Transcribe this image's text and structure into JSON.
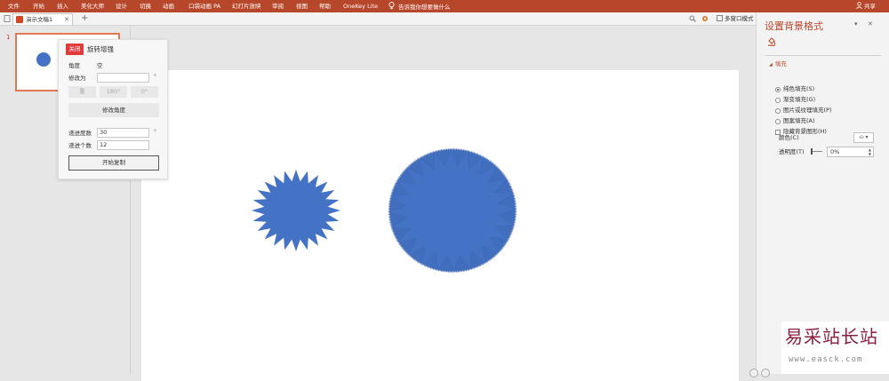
{
  "ribbon": {
    "tabs": [
      "文件",
      "开始",
      "插入",
      "美化大师",
      "设计",
      "切换",
      "动画",
      "口袋动画 PA",
      "幻灯片放映",
      "审阅",
      "视图",
      "帮助",
      "OneKey Lite"
    ],
    "tell_me": "告诉我你想要做什么",
    "share": "共享",
    "color": "#b7472a"
  },
  "tabbar": {
    "doc_title": "演示文稿1",
    "close": "✕",
    "new_tab": "+",
    "multi_window": "多窗口模式"
  },
  "thumbnails": {
    "slide_number": "1"
  },
  "popup": {
    "close_label": "关闭",
    "title": "旋转增强",
    "angle_label": "角度",
    "angle_value": "空",
    "modify_to_label": "修改为",
    "modify_to_value": "",
    "degree_symbol": "°",
    "btn_reset": "重",
    "btn_180": "180°",
    "btn_0": "0°",
    "modify_angle_button": "修改角度",
    "increment_degree_label": "递进度数",
    "increment_degree_value": "30",
    "increment_count_label": "递进个数",
    "increment_count_value": "12",
    "start_copy_button": "开始复制"
  },
  "format_pane": {
    "title": "设置背景格式",
    "section_fill": "填充",
    "options": [
      {
        "label": "纯色填充(S)",
        "selected": true
      },
      {
        "label": "渐变填充(G)",
        "selected": false
      },
      {
        "label": "图片或纹理填充(P)",
        "selected": false
      },
      {
        "label": "图案填充(A)",
        "selected": false
      }
    ],
    "hide_background": "隐藏背景图形(H)",
    "color_label": "颜色(C)",
    "transparency_label": "透明度(T)",
    "transparency_value": "0%"
  },
  "watermark": {
    "big": "易采站长站",
    "small": "www.easck.com"
  },
  "shape_color": "#4472c4"
}
